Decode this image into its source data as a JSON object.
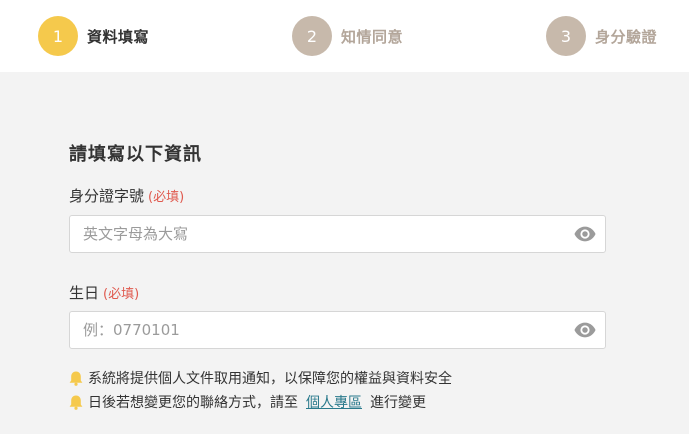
{
  "stepper": {
    "steps": [
      {
        "number": "1",
        "label": "資料填寫"
      },
      {
        "number": "2",
        "label": "知情同意"
      },
      {
        "number": "3",
        "label": "身分驗證"
      }
    ],
    "colors": {
      "active_circle": "#f5c94c",
      "inactive_circle": "#c7b9ab",
      "active_label": "#333333",
      "inactive_label": "#b3a69a"
    }
  },
  "form": {
    "title": "請填寫以下資訊",
    "required_text": "(必填)",
    "required_color": "#e05a4f",
    "fields": {
      "id_number": {
        "label": "身分證字號",
        "placeholder": "英文字母為大寫",
        "value": "",
        "icon": "eye-icon"
      },
      "birthday": {
        "label": "生日",
        "placeholder": "例：0770101",
        "value": "",
        "icon": "eye-icon"
      }
    }
  },
  "notices": {
    "icon": "bell-icon",
    "icon_color": "#f5c94c",
    "line1": "系統將提供個人文件取用通知，以保障您的權益與資料安全",
    "line2_prefix": "日後若想變更您的聯絡方式，請至",
    "line2_link": "個人專區",
    "line2_suffix": "進行變更",
    "link_color": "#2a7a8c"
  }
}
